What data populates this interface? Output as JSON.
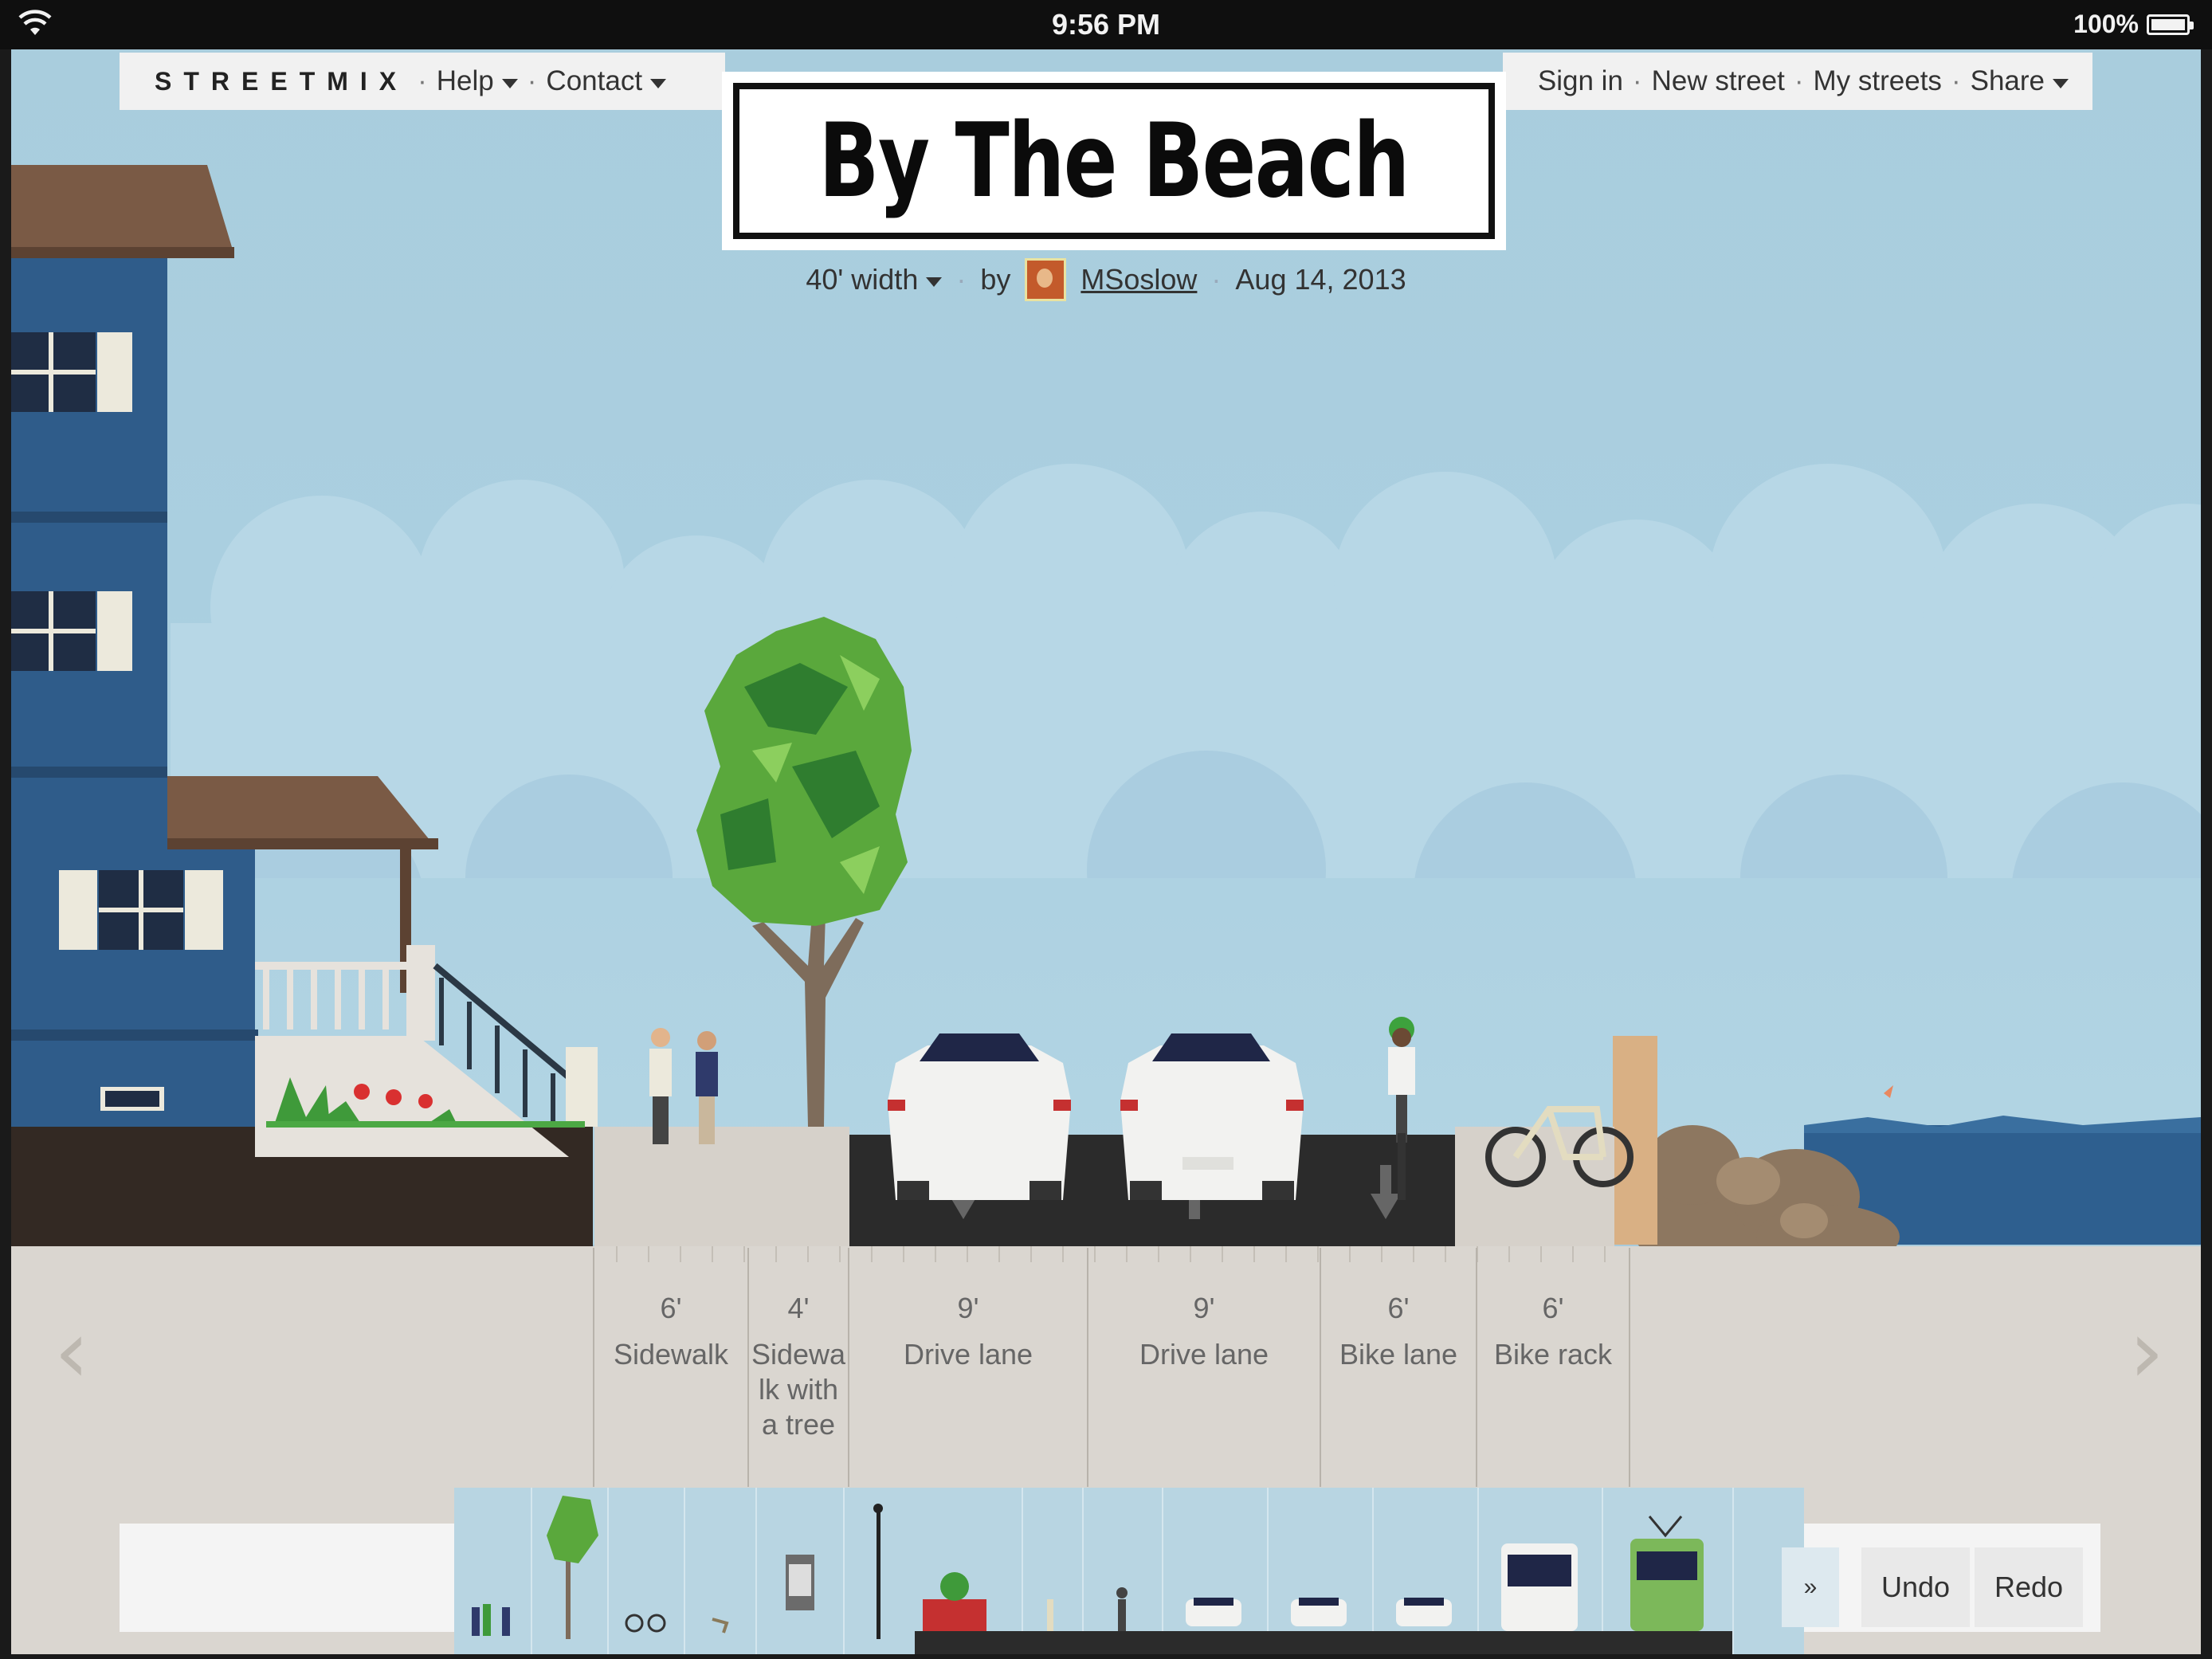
{
  "status_bar": {
    "time": "9:56 PM",
    "battery": "100%"
  },
  "menu": {
    "logo": "STREETMIX",
    "help": "Help",
    "contact": "Contact",
    "sign_in": "Sign in",
    "new_street": "New street",
    "my_streets": "My streets",
    "share": "Share"
  },
  "street": {
    "title": "By The Beach",
    "width": "40' width",
    "by": "by",
    "author": "MSoslow",
    "date": "Aug 14, 2013"
  },
  "segments": [
    {
      "width": "6'",
      "name": "Sidewalk"
    },
    {
      "width": "4'",
      "name": "Sidewa lk with a tree"
    },
    {
      "width": "9'",
      "name": "Drive lane"
    },
    {
      "width": "9'",
      "name": "Drive lane"
    },
    {
      "width": "6'",
      "name": "Bike lane"
    },
    {
      "width": "6'",
      "name": "Bike rack"
    }
  ],
  "nav": {
    "prev": "‹",
    "next": "›"
  },
  "palette": {
    "more": "»",
    "undo": "Undo",
    "redo": "Redo",
    "items": [
      "sidewalk-people",
      "tree",
      "bike-rack",
      "bench",
      "newspaper-box",
      "street-lamp",
      "planter",
      "bollard",
      "bike-lane",
      "car-lane",
      "turn-lane",
      "car",
      "bus-lane",
      "light-rail"
    ]
  },
  "colors": {
    "sky": "#a9cddd",
    "building": "#2f5c8a",
    "asphalt": "#2b2b2b",
    "sidewalk": "#dad6d0",
    "sea": "#2e5f8f",
    "tree": "#5aa83c"
  }
}
